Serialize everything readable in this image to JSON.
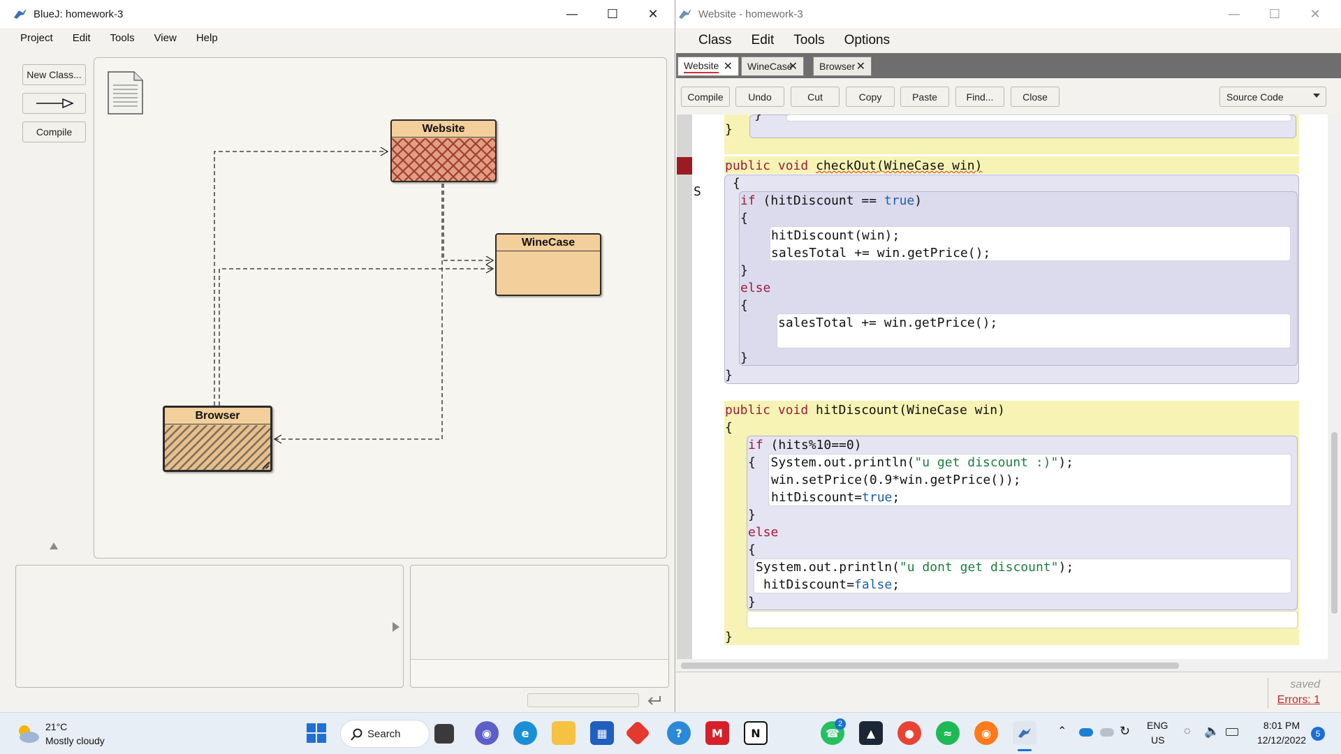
{
  "bluej": {
    "title": "BlueJ:  homework-3",
    "menu": [
      "Project",
      "Edit",
      "Tools",
      "View",
      "Help"
    ],
    "buttons": {
      "new_class": "New Class...",
      "compile": "Compile"
    },
    "classes": {
      "website": "Website",
      "winecase": "WineCase",
      "browser": "Browser"
    }
  },
  "editor": {
    "title": "Website - homework-3",
    "menu": [
      "Class",
      "Edit",
      "Tools",
      "Options"
    ],
    "tabs": [
      "Website",
      "WineCase",
      "Browser"
    ],
    "toolbar": [
      "Compile",
      "Undo",
      "Cut",
      "Copy",
      "Paste",
      "Find...",
      "Close"
    ],
    "view_mode": "Source Code",
    "gutter_letter": "S",
    "code": {
      "l0": "}",
      "l1": "}",
      "l2a": "public void ",
      "l2b": "checkOut(WineCase win)",
      "l3": "{",
      "l4a": "if ",
      "l4b": "(hitDiscount == ",
      "l4c": "true",
      "l4d": ")",
      "l5": "{",
      "l6": "hitDiscount(win);",
      "l7": "salesTotal += win.getPrice();",
      "l8": "}",
      "l9": "else",
      "l10": "{",
      "l11": "salesTotal += win.getPrice();",
      "l12": "}",
      "l13": "}",
      "l14a": "public void ",
      "l14b": "hitDiscount(WineCase win)",
      "l15": "{",
      "l16a": "if ",
      "l16b": "(hits%10==0)",
      "l17a": "{  System.out.println(",
      "l17b": "\"u get discount :)\"",
      "l17c": ");",
      "l18": "win.setPrice(0.9*win.getPrice());",
      "l19a": "hitDiscount=",
      "l19b": "true",
      "l19c": ";",
      "l20": "}",
      "l21": "else",
      "l22": "{",
      "l23a": "System.out.println(",
      "l23b": "\"u dont get discount\"",
      "l23c": ");",
      "l24a": "hitDiscount=",
      "l24b": "false",
      "l24c": ";",
      "l25": "}",
      "l26": "}"
    },
    "status": {
      "saved": "saved",
      "errors": "Errors: 1"
    }
  },
  "taskbar": {
    "weather_temp": "21°C",
    "weather_desc": "Mostly cloudy",
    "search": "Search",
    "lang": "ENG",
    "region": "US",
    "time": "8:01 PM",
    "date": "12/12/2022",
    "notifications": "5",
    "whatsapp_badge": "2"
  }
}
